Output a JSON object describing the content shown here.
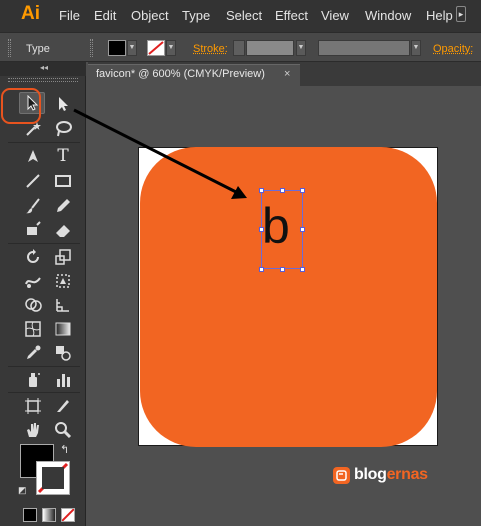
{
  "app": {
    "logo": "Ai"
  },
  "menu": [
    "File",
    "Edit",
    "Object",
    "Type",
    "Select",
    "Effect",
    "View",
    "Window",
    "Help"
  ],
  "control": {
    "type_label": "Type",
    "stroke_label": "Stroke:",
    "opacity_label": "Opacity:"
  },
  "document": {
    "tab_title": "favicon* @ 600% (CMYK/Preview)",
    "close_glyph": "×",
    "letter": "b"
  },
  "toolbar": {
    "collapse_glyph": "◂◂"
  },
  "colors": {
    "accent": "#f26522",
    "highlight": "#e8541f",
    "selection": "#5c5cd6",
    "ai_orange": "#ff9a00"
  },
  "watermark": {
    "text_prefix": "blog",
    "text_suffix": "ernas"
  }
}
